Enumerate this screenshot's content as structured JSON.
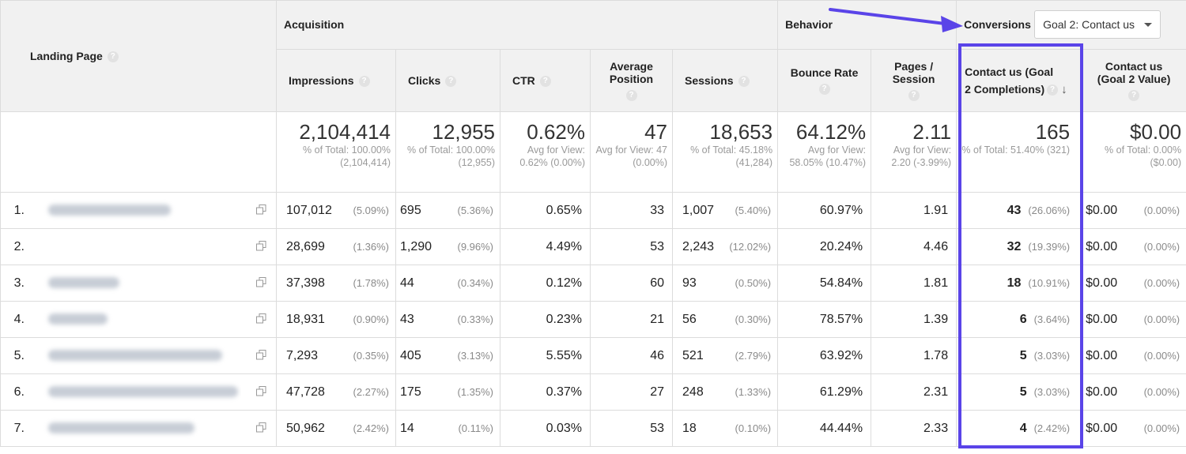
{
  "groups": {
    "landing_page": "Landing Page",
    "acquisition": "Acquisition",
    "behavior": "Behavior",
    "conversions": "Conversions",
    "goal_select": "Goal 2: Contact us"
  },
  "columns": {
    "impressions": "Impressions",
    "clicks": "Clicks",
    "ctr": "CTR",
    "avg_position": "Average Position",
    "sessions": "Sessions",
    "bounce_rate": "Bounce Rate",
    "pages_session": "Pages / Session",
    "goal2_completions": "Contact us (Goal 2 Completions)",
    "goal2_value": "Contact us (Goal 2 Value)"
  },
  "totals": {
    "impressions": {
      "big": "2,104,414",
      "sub": "% of Total: 100.00% (2,104,414)"
    },
    "clicks": {
      "big": "12,955",
      "sub": "% of Total: 100.00% (12,955)"
    },
    "ctr": {
      "big": "0.62%",
      "sub": "Avg for View: 0.62% (0.00%)"
    },
    "avg_position": {
      "big": "47",
      "sub": "Avg for View: 47 (0.00%)"
    },
    "sessions": {
      "big": "18,653",
      "sub": "% of Total: 45.18% (41,284)"
    },
    "bounce_rate": {
      "big": "64.12%",
      "sub": "Avg for View: 58.05% (10.47%)"
    },
    "pages_session": {
      "big": "2.11",
      "sub": "Avg for View: 2.20 (-3.99%)"
    },
    "goal2_completions": {
      "big": "165",
      "sub": "% of Total: 51.40% (321)"
    },
    "goal2_value": {
      "big": "$0.00",
      "sub": "% of Total: 0.00% ($0.00)"
    }
  },
  "rows": [
    {
      "n": "1.",
      "impr": "107,012",
      "impr_pct": "(5.09%)",
      "clicks": "695",
      "clicks_pct": "(5.36%)",
      "ctr": "0.65%",
      "pos": "33",
      "sess": "1,007",
      "sess_pct": "(5.40%)",
      "bounce": "60.97%",
      "pps": "1.91",
      "goal": "43",
      "goal_pct": "(26.06%)",
      "value": "$0.00",
      "value_pct": "(0.00%)"
    },
    {
      "n": "2.",
      "impr": "28,699",
      "impr_pct": "(1.36%)",
      "clicks": "1,290",
      "clicks_pct": "(9.96%)",
      "ctr": "4.49%",
      "pos": "53",
      "sess": "2,243",
      "sess_pct": "(12.02%)",
      "bounce": "20.24%",
      "pps": "4.46",
      "goal": "32",
      "goal_pct": "(19.39%)",
      "value": "$0.00",
      "value_pct": "(0.00%)"
    },
    {
      "n": "3.",
      "impr": "37,398",
      "impr_pct": "(1.78%)",
      "clicks": "44",
      "clicks_pct": "(0.34%)",
      "ctr": "0.12%",
      "pos": "60",
      "sess": "93",
      "sess_pct": "(0.50%)",
      "bounce": "54.84%",
      "pps": "1.81",
      "goal": "18",
      "goal_pct": "(10.91%)",
      "value": "$0.00",
      "value_pct": "(0.00%)"
    },
    {
      "n": "4.",
      "impr": "18,931",
      "impr_pct": "(0.90%)",
      "clicks": "43",
      "clicks_pct": "(0.33%)",
      "ctr": "0.23%",
      "pos": "21",
      "sess": "56",
      "sess_pct": "(0.30%)",
      "bounce": "78.57%",
      "pps": "1.39",
      "goal": "6",
      "goal_pct": "(3.64%)",
      "value": "$0.00",
      "value_pct": "(0.00%)"
    },
    {
      "n": "5.",
      "impr": "7,293",
      "impr_pct": "(0.35%)",
      "clicks": "405",
      "clicks_pct": "(3.13%)",
      "ctr": "5.55%",
      "pos": "46",
      "sess": "521",
      "sess_pct": "(2.79%)",
      "bounce": "63.92%",
      "pps": "1.78",
      "goal": "5",
      "goal_pct": "(3.03%)",
      "value": "$0.00",
      "value_pct": "(0.00%)"
    },
    {
      "n": "6.",
      "impr": "47,728",
      "impr_pct": "(2.27%)",
      "clicks": "175",
      "clicks_pct": "(1.35%)",
      "ctr": "0.37%",
      "pos": "27",
      "sess": "248",
      "sess_pct": "(1.33%)",
      "bounce": "61.29%",
      "pps": "2.31",
      "goal": "5",
      "goal_pct": "(3.03%)",
      "value": "$0.00",
      "value_pct": "(0.00%)"
    },
    {
      "n": "7.",
      "impr": "50,962",
      "impr_pct": "(2.42%)",
      "clicks": "14",
      "clicks_pct": "(0.11%)",
      "ctr": "0.03%",
      "pos": "53",
      "sess": "18",
      "sess_pct": "(0.10%)",
      "bounce": "44.44%",
      "pps": "2.33",
      "goal": "4",
      "goal_pct": "(2.42%)",
      "value": "$0.00",
      "value_pct": "(0.00%)"
    }
  ],
  "colors": {
    "highlight": "#5a44e8",
    "header_bg": "#f1f1f1"
  }
}
